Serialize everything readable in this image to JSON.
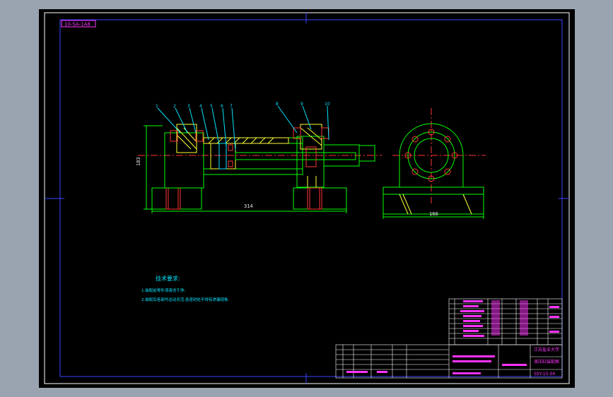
{
  "drawing": {
    "code_box": "10-SA-1A8",
    "dims": {
      "height": "183",
      "length": "314",
      "width": "160"
    },
    "balloons": [
      "1",
      "2",
      "3",
      "4",
      "5",
      "6",
      "7",
      "8",
      "9",
      "10"
    ],
    "tech_req": {
      "title": "技术要求:",
      "line1": "1.装配前零件须清洗干净;",
      "line2": "2.装配后各部件运动灵活,各密封处不得有渗漏现象."
    },
    "title_block": {
      "org": "江苏盐业大学",
      "name": "液压缸装配图",
      "code": "SSY-15-04"
    }
  },
  "colors": {
    "frame": "#3a44ff",
    "outline": "#00ff00",
    "label": "#00e5ff",
    "title": "#ff33ff",
    "hatch": "#ff3333",
    "part": "#ffff33"
  }
}
